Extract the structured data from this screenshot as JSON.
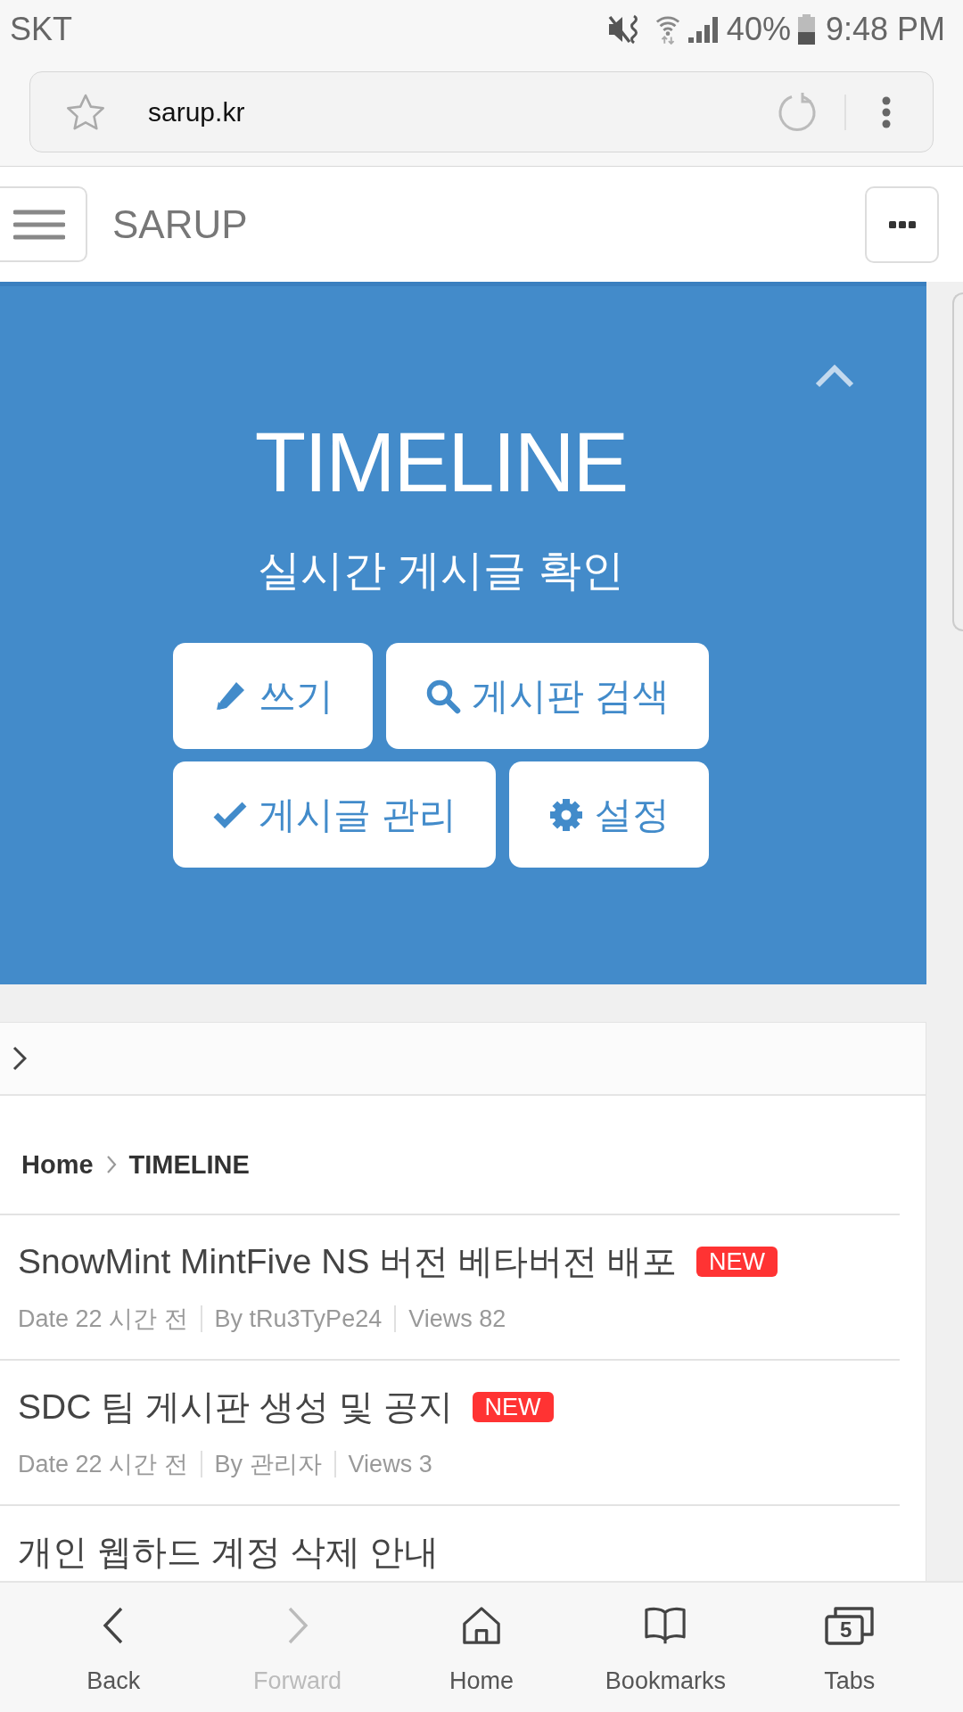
{
  "status_bar": {
    "carrier": "SKT",
    "battery": "40%",
    "time": "9:48 PM"
  },
  "address_bar": {
    "url": "sarup.kr"
  },
  "site_header": {
    "title": "SARUP"
  },
  "hero": {
    "title": "TIMELINE",
    "subtitle": "실시간 게시글 확인",
    "button_rows": [
      [
        {
          "label": "쓰기",
          "kind": "write"
        },
        {
          "label": "게시판 검색",
          "kind": "search"
        }
      ],
      [
        {
          "label": "게시글 관리",
          "kind": "manage"
        },
        {
          "label": "설정",
          "kind": "settings"
        }
      ]
    ]
  },
  "breadcrumb": [
    "Home",
    "TIMELINE"
  ],
  "posts": [
    {
      "title": "SnowMint MintFive NS 버전 베타버전 배포",
      "badge": "NEW",
      "date": "Date 22 시간 전",
      "author": "By tRu3TyPe24",
      "views": "Views 82"
    },
    {
      "title": "SDC 팀 게시판 생성 및 공지",
      "badge": "NEW",
      "date": "Date 22 시간 전",
      "author": "By 관리자",
      "views": "Views 3"
    },
    {
      "title": "개인 웹하드 계정 삭제 안내"
    }
  ],
  "bottom_nav": [
    {
      "label": "Back",
      "kind": "back",
      "disabled": false
    },
    {
      "label": "Forward",
      "kind": "forward",
      "disabled": true
    },
    {
      "label": "Home",
      "kind": "home",
      "disabled": false
    },
    {
      "label": "Bookmarks",
      "kind": "bookmarks",
      "disabled": false
    },
    {
      "label": "Tabs",
      "kind": "tabs",
      "disabled": false,
      "count": "5"
    }
  ]
}
